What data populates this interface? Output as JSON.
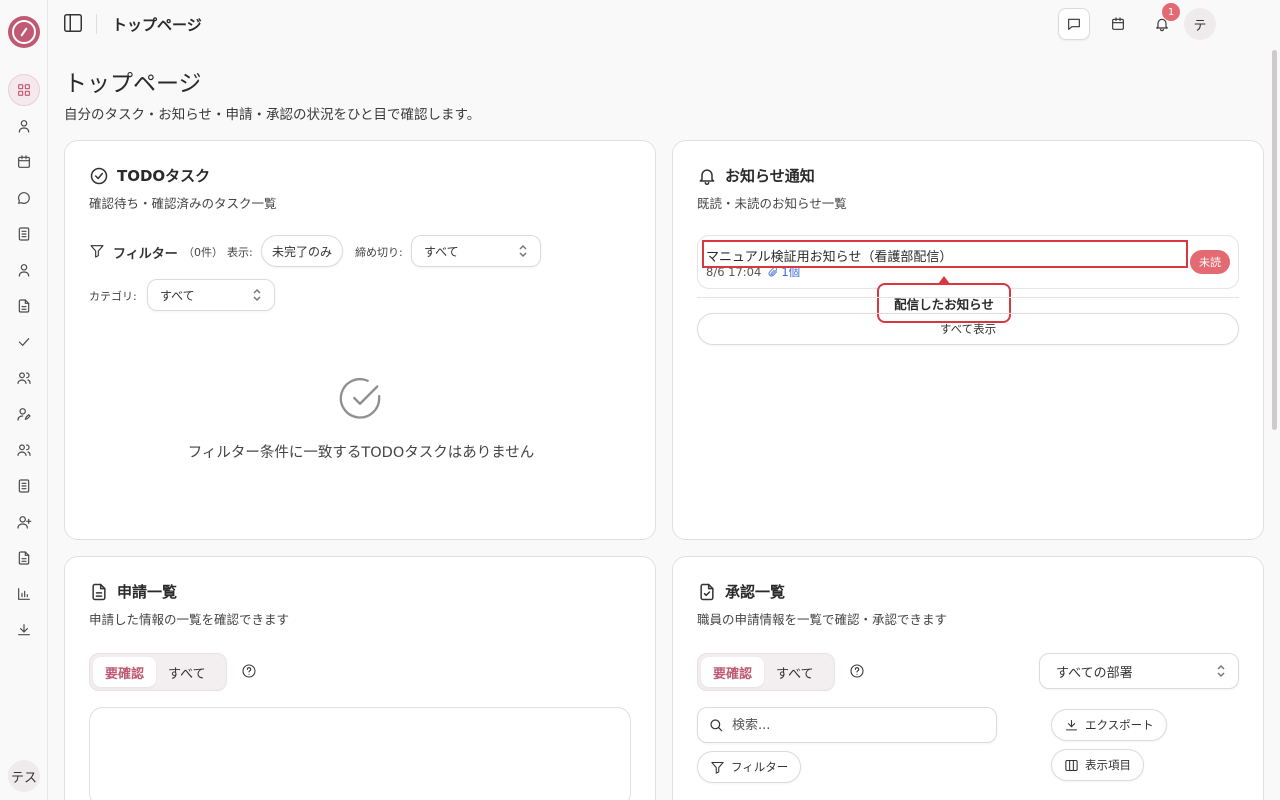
{
  "app": {
    "page_title": "トップページ",
    "page_subtitle": "自分のタスク・お知らせ・申請・承認の状況をひと目で確認します。",
    "accent_color": "#c05a73",
    "badge_color": "#e36a73",
    "highlight_color": "#d9373f"
  },
  "topbar": {
    "breadcrumb": "トップページ",
    "notification_count": "1",
    "user_avatar": "テ",
    "icons": [
      "message-square-icon",
      "calendar-icon",
      "bell-icon",
      "chat-bubble-icon"
    ]
  },
  "sidebar": {
    "items": [
      {
        "icon": "dashboard-grid-icon",
        "active": true
      },
      {
        "icon": "user-icon"
      },
      {
        "icon": "calendar-icon"
      },
      {
        "icon": "chat-icon"
      },
      {
        "icon": "notebook-icon"
      },
      {
        "icon": "user-icon"
      },
      {
        "icon": "file-text-icon"
      },
      {
        "icon": "check-icon"
      },
      {
        "icon": "users-icon"
      },
      {
        "icon": "user-edit-icon"
      },
      {
        "icon": "users-icon"
      },
      {
        "icon": "notebook-icon"
      },
      {
        "icon": "user-plus-icon"
      },
      {
        "icon": "file-text-icon"
      },
      {
        "icon": "bar-chart-icon"
      },
      {
        "icon": "download-icon"
      }
    ],
    "user_avatar": "テス"
  },
  "todo": {
    "title": "TODOタスク",
    "description": "確認待ち・確認済みのタスク一覧",
    "filter_label": "フィルター",
    "filter_count": "（0件）",
    "display_label": "表示:",
    "display_value": "未完了のみ",
    "deadline_label": "締め切り:",
    "deadline_value": "すべて",
    "category_label": "カテゴリ:",
    "category_value": "すべて",
    "empty_message": "フィルター条件に一致するTODOタスクはありません"
  },
  "notices": {
    "title": "お知らせ通知",
    "description": "既読・未読のお知らせ一覧",
    "items": [
      {
        "title": "マニュアル検証用お知らせ（看護部配信）",
        "datetime": "8/6 17:04",
        "attachments": "1個",
        "status": "未読"
      }
    ],
    "tooltip": "配信したお知らせ",
    "show_all": "すべて表示"
  },
  "applications": {
    "title": "申請一覧",
    "description": "申請した情報の一覧を確認できます",
    "tabs": [
      "要確認",
      "すべて"
    ]
  },
  "approvals": {
    "title": "承認一覧",
    "description": "職員の申請情報を一覧で確認・承認できます",
    "tabs": [
      "要確認",
      "すべて"
    ],
    "department_value": "すべての部署",
    "search_placeholder": "検索...",
    "filter_button": "フィルター",
    "export_button": "エクスポート",
    "columns_button": "表示項目"
  }
}
